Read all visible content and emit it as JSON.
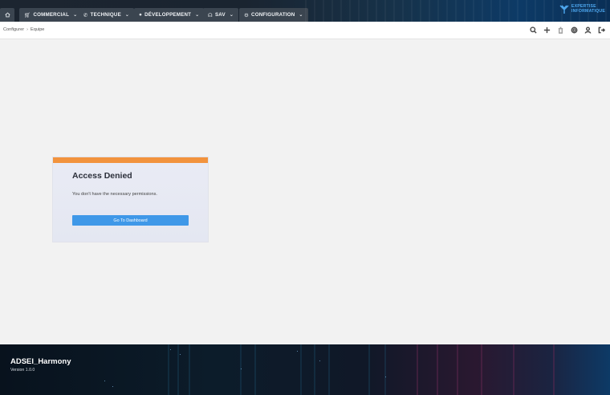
{
  "nav": {
    "items": [
      {
        "label": "COMMERCIAL",
        "icon": "cart-icon"
      },
      {
        "label": "TECHNIQUE",
        "icon": "phone-icon"
      },
      {
        "label": "DÉVELOPPEMENT",
        "icon": "apple-icon"
      },
      {
        "label": "SAV",
        "icon": "headset-icon"
      },
      {
        "label": "CONFIGURATION",
        "icon": "settings-icon"
      }
    ],
    "logo_line1": "EXPERTISE",
    "logo_line2": "INFORMATIQUE"
  },
  "breadcrumb": {
    "items": [
      "Configurer",
      "Equipe"
    ]
  },
  "toolbar": {
    "icons": [
      "search-icon",
      "plus-icon",
      "trash-icon",
      "gear-icon",
      "user-icon",
      "logout-icon"
    ]
  },
  "access": {
    "title": "Access Denied",
    "message": "You don't have the necessary permissions.",
    "button": "Go To Dashboard"
  },
  "footer": {
    "title": "ADSEI_Harmony",
    "version": "Version 1.0.0"
  },
  "colors": {
    "accent_orange": "#f2933d",
    "button_blue": "#3f98e8",
    "nav_item_bg": "#3b4550"
  }
}
